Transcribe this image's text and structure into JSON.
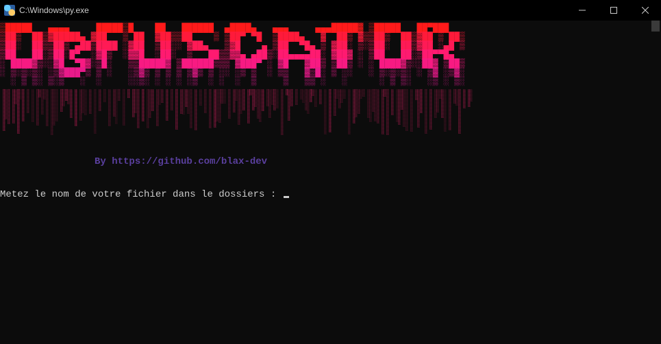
{
  "window": {
    "title": "C:\\Windows\\py.exe"
  },
  "banner": {
    "text": "OBFUSCATOR",
    "lines": [
      "▒█████   ▄▄▄▄     █████▒█    ██   ██████  ▄████▄   ▄▄▄     ▄▄▄█████▓ ▒█████   ██▀███  ",
      "▒██▒  ██▒▓█████▄ ▓██   ▒ ██  ▓██▒▒██    ▒ ▒██▀ ▀█  ▒████▄   ▓  ██▒ ▓▒▒██▒  ██▒▓██ ▒ ██▒",
      "▒██░  ██▒▒██▒ ▄██▒████ ░▓██  ▒██░░ ▓██▄   ▒▓█    ▄ ▒██  ▀█▄ ▒ ▓██░ ▒░▒██░  ██▒▓██ ░▄█ ▒",
      "▒██   ██░▒██░█▀  ░▓█▒  ░▓▓█  ░██░  ▒   ██▒▒▓▓▄ ▄██▒░██▄▄▄▄██░ ▓██▓ ░ ▒██   ██░▒██▀▀█▄  ",
      "░ ████▓▒░░▓█  ▀█▓░▒█░   ▒▒█████▓ ▒██████▒▒▒ ▓███▀ ░ ▓█   ▓██▒ ▒██▒ ░ ░ ████▓▒░░██▓ ▒██▒",
      "░ ▒░▒░▒░ ░▒▓███▀▒ ▒ ░   ░▒▓▒ ▒ ▒ ▒ ▒▓▒ ▒ ░░ ░▒ ▒  ░ ▒▒   ▓▒█░ ▒ ░░   ░ ▒░▒░▒░ ░ ▒▓ ░▒▓░",
      "  ░ ▒ ▒░ ▒░▒   ░  ░     ░░▒░ ░ ░ ░ ░▒  ░ ░  ░  ▒     ▒   ▒▒ ░   ░      ░ ▒ ▒░   ░▒ ░ ▒░"
    ]
  },
  "credit": {
    "prefix": "By ",
    "url": "https://github.com/blax-dev"
  },
  "prompt": {
    "text": "Metez le nom de votre fichier dans le dossiers : "
  }
}
